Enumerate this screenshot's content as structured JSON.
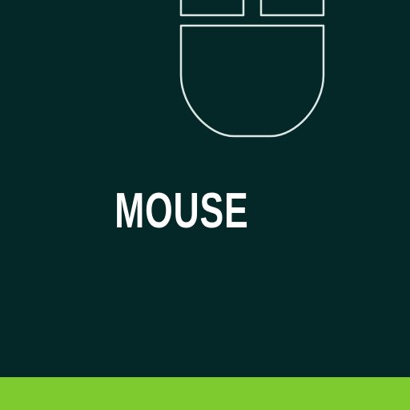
{
  "label": "MOUSE",
  "icon": "computer-mouse-icon",
  "colors": {
    "background": "#032827",
    "outline": "#dde7e5",
    "label": "#ffffff",
    "accent_bar": "#7dcb2e"
  }
}
